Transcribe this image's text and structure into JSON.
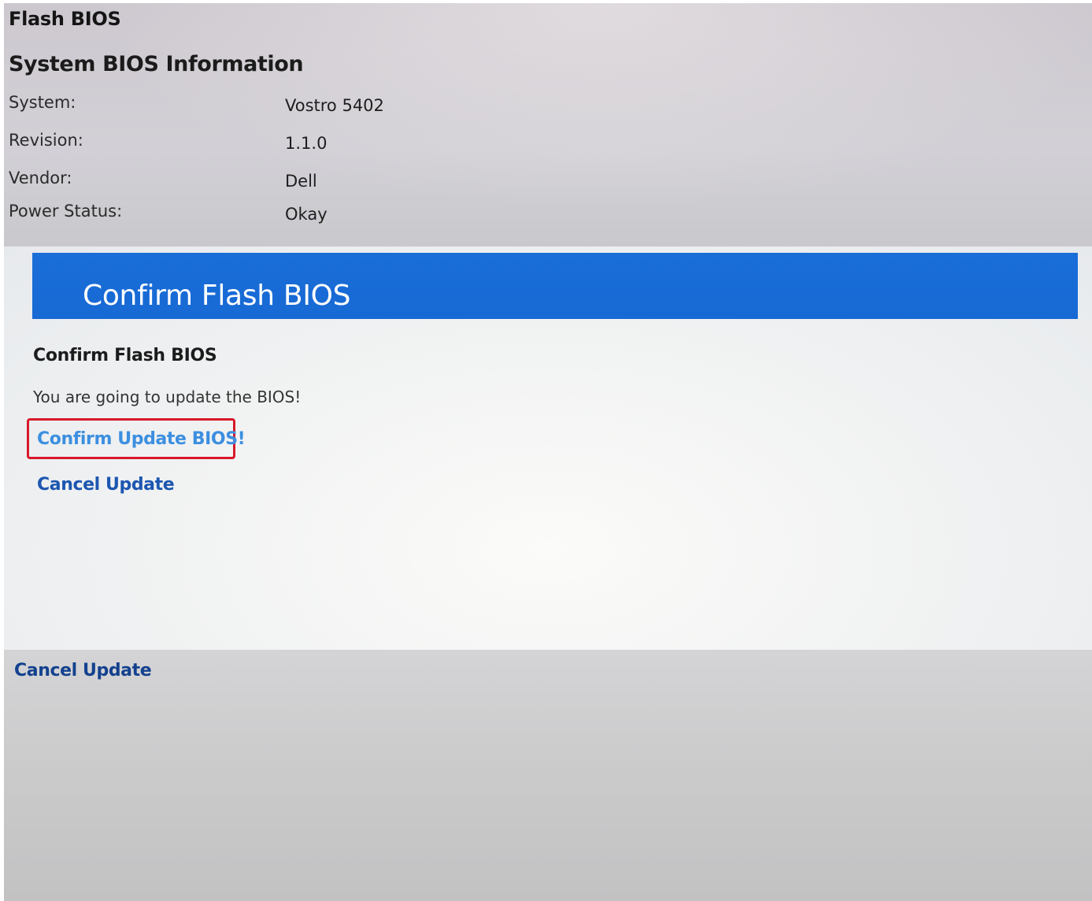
{
  "page": {
    "title": "Flash BIOS"
  },
  "system_info": {
    "heading": "System BIOS Information",
    "rows": [
      {
        "label": "System:",
        "value": "Vostro 5402"
      },
      {
        "label": "Revision:",
        "value": "1.1.0"
      },
      {
        "label": "Vendor:",
        "value": "Dell"
      },
      {
        "label": "Power Status:",
        "value": "Okay"
      }
    ]
  },
  "dialog": {
    "header_title": "Confirm Flash BIOS",
    "subtitle": "Confirm Flash BIOS",
    "message": "You are going to update the BIOS!",
    "confirm_label": "Confirm Update BIOS!",
    "cancel_label": "Cancel Update"
  },
  "footer": {
    "cancel_label": "Cancel Update"
  },
  "colors": {
    "header_blue": "#1769d4",
    "highlight_red": "#d8182a",
    "link_light_blue": "#3c8fe0",
    "link_blue": "#1c56b0",
    "link_dark_blue": "#13418e"
  }
}
